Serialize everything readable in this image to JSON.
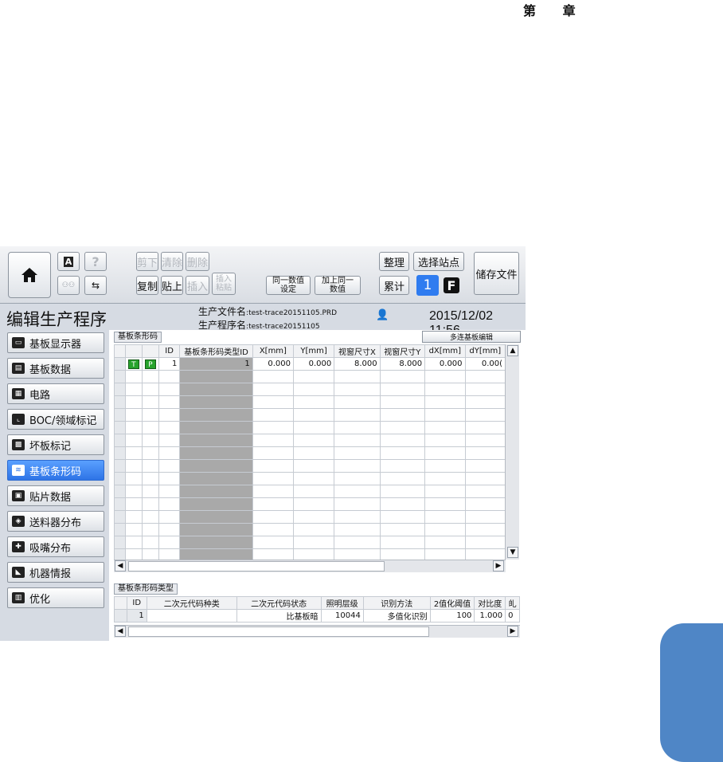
{
  "page": {
    "chapter_label": "第 章"
  },
  "toolbar": {
    "cut": "剪下",
    "clear": "清除",
    "delete": "删除",
    "copy": "复制",
    "paste": "贴上",
    "insert": "插入",
    "insert_paste": "插入\n粘贴",
    "same_value_set": "同一数值\n设定",
    "add_same_value": "加上同一\n数值",
    "arrange": "整理",
    "select_station": "选择站点",
    "accumulate": "累计",
    "station_number": "1",
    "f_label": "F",
    "save_file": "储存文件"
  },
  "header": {
    "title": "编辑生产程序",
    "file_key": "生产文件名",
    "file_value": "test-trace20151105.PRD",
    "program_key": "生产程序名",
    "program_value": "test-trace20151105",
    "datetime": "2015/12/02 11:56"
  },
  "sidebar": {
    "items": [
      {
        "label": "基板显示器",
        "icon": "monitor-icon"
      },
      {
        "label": "基板数据",
        "icon": "board-data-icon"
      },
      {
        "label": "电路",
        "icon": "circuit-icon"
      },
      {
        "label": "BOC/领域标记",
        "icon": "boc-mark-icon"
      },
      {
        "label": "坏板标记",
        "icon": "bad-board-icon"
      },
      {
        "label": "基板条形码",
        "icon": "barcode-icon"
      },
      {
        "label": "贴片数据",
        "icon": "placement-icon"
      },
      {
        "label": "送料器分布",
        "icon": "feeder-icon"
      },
      {
        "label": "吸嘴分布",
        "icon": "nozzle-icon"
      },
      {
        "label": "机器情报",
        "icon": "machine-icon"
      },
      {
        "label": "优化",
        "icon": "optimize-icon"
      }
    ],
    "active_index": 5
  },
  "barcode_panel": {
    "label": "基板条形码",
    "multi_edit": "多连基板编辑",
    "columns": [
      "ID",
      "基板条形码类型ID",
      "X[mm]",
      "Y[mm]",
      "视窗尺寸X",
      "视窗尺寸Y",
      "dX[mm]",
      "dY[mm]"
    ],
    "rows": [
      {
        "t": "T",
        "p": "P",
        "id": "1",
        "type_id": "1",
        "x": "0.000",
        "y": "0.000",
        "wx": "8.000",
        "wy": "8.000",
        "dx": "0.000",
        "dy": "0.00("
      }
    ]
  },
  "type_panel": {
    "label": "基板条形码类型",
    "columns": [
      "ID",
      "二次元代码种类",
      "二次元代码状态",
      "照明层级",
      "识别方法",
      "2值化阈值",
      "对比度",
      "癿"
    ],
    "rows": [
      {
        "id": "1",
        "kind": "",
        "state": "比基板暗",
        "light": "10044",
        "method": "多值化识别",
        "threshold": "100",
        "contrast": "1.000",
        "extra": "0"
      }
    ]
  }
}
